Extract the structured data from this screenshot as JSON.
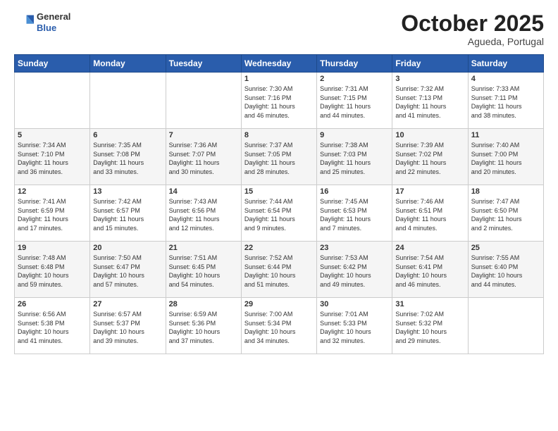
{
  "header": {
    "logo_general": "General",
    "logo_blue": "Blue",
    "month_title": "October 2025",
    "subtitle": "Agueda, Portugal"
  },
  "weekdays": [
    "Sunday",
    "Monday",
    "Tuesday",
    "Wednesday",
    "Thursday",
    "Friday",
    "Saturday"
  ],
  "weeks": [
    [
      {
        "day": "",
        "info": ""
      },
      {
        "day": "",
        "info": ""
      },
      {
        "day": "",
        "info": ""
      },
      {
        "day": "1",
        "info": "Sunrise: 7:30 AM\nSunset: 7:16 PM\nDaylight: 11 hours\nand 46 minutes."
      },
      {
        "day": "2",
        "info": "Sunrise: 7:31 AM\nSunset: 7:15 PM\nDaylight: 11 hours\nand 44 minutes."
      },
      {
        "day": "3",
        "info": "Sunrise: 7:32 AM\nSunset: 7:13 PM\nDaylight: 11 hours\nand 41 minutes."
      },
      {
        "day": "4",
        "info": "Sunrise: 7:33 AM\nSunset: 7:11 PM\nDaylight: 11 hours\nand 38 minutes."
      }
    ],
    [
      {
        "day": "5",
        "info": "Sunrise: 7:34 AM\nSunset: 7:10 PM\nDaylight: 11 hours\nand 36 minutes."
      },
      {
        "day": "6",
        "info": "Sunrise: 7:35 AM\nSunset: 7:08 PM\nDaylight: 11 hours\nand 33 minutes."
      },
      {
        "day": "7",
        "info": "Sunrise: 7:36 AM\nSunset: 7:07 PM\nDaylight: 11 hours\nand 30 minutes."
      },
      {
        "day": "8",
        "info": "Sunrise: 7:37 AM\nSunset: 7:05 PM\nDaylight: 11 hours\nand 28 minutes."
      },
      {
        "day": "9",
        "info": "Sunrise: 7:38 AM\nSunset: 7:03 PM\nDaylight: 11 hours\nand 25 minutes."
      },
      {
        "day": "10",
        "info": "Sunrise: 7:39 AM\nSunset: 7:02 PM\nDaylight: 11 hours\nand 22 minutes."
      },
      {
        "day": "11",
        "info": "Sunrise: 7:40 AM\nSunset: 7:00 PM\nDaylight: 11 hours\nand 20 minutes."
      }
    ],
    [
      {
        "day": "12",
        "info": "Sunrise: 7:41 AM\nSunset: 6:59 PM\nDaylight: 11 hours\nand 17 minutes."
      },
      {
        "day": "13",
        "info": "Sunrise: 7:42 AM\nSunset: 6:57 PM\nDaylight: 11 hours\nand 15 minutes."
      },
      {
        "day": "14",
        "info": "Sunrise: 7:43 AM\nSunset: 6:56 PM\nDaylight: 11 hours\nand 12 minutes."
      },
      {
        "day": "15",
        "info": "Sunrise: 7:44 AM\nSunset: 6:54 PM\nDaylight: 11 hours\nand 9 minutes."
      },
      {
        "day": "16",
        "info": "Sunrise: 7:45 AM\nSunset: 6:53 PM\nDaylight: 11 hours\nand 7 minutes."
      },
      {
        "day": "17",
        "info": "Sunrise: 7:46 AM\nSunset: 6:51 PM\nDaylight: 11 hours\nand 4 minutes."
      },
      {
        "day": "18",
        "info": "Sunrise: 7:47 AM\nSunset: 6:50 PM\nDaylight: 11 hours\nand 2 minutes."
      }
    ],
    [
      {
        "day": "19",
        "info": "Sunrise: 7:48 AM\nSunset: 6:48 PM\nDaylight: 10 hours\nand 59 minutes."
      },
      {
        "day": "20",
        "info": "Sunrise: 7:50 AM\nSunset: 6:47 PM\nDaylight: 10 hours\nand 57 minutes."
      },
      {
        "day": "21",
        "info": "Sunrise: 7:51 AM\nSunset: 6:45 PM\nDaylight: 10 hours\nand 54 minutes."
      },
      {
        "day": "22",
        "info": "Sunrise: 7:52 AM\nSunset: 6:44 PM\nDaylight: 10 hours\nand 51 minutes."
      },
      {
        "day": "23",
        "info": "Sunrise: 7:53 AM\nSunset: 6:42 PM\nDaylight: 10 hours\nand 49 minutes."
      },
      {
        "day": "24",
        "info": "Sunrise: 7:54 AM\nSunset: 6:41 PM\nDaylight: 10 hours\nand 46 minutes."
      },
      {
        "day": "25",
        "info": "Sunrise: 7:55 AM\nSunset: 6:40 PM\nDaylight: 10 hours\nand 44 minutes."
      }
    ],
    [
      {
        "day": "26",
        "info": "Sunrise: 6:56 AM\nSunset: 5:38 PM\nDaylight: 10 hours\nand 41 minutes."
      },
      {
        "day": "27",
        "info": "Sunrise: 6:57 AM\nSunset: 5:37 PM\nDaylight: 10 hours\nand 39 minutes."
      },
      {
        "day": "28",
        "info": "Sunrise: 6:59 AM\nSunset: 5:36 PM\nDaylight: 10 hours\nand 37 minutes."
      },
      {
        "day": "29",
        "info": "Sunrise: 7:00 AM\nSunset: 5:34 PM\nDaylight: 10 hours\nand 34 minutes."
      },
      {
        "day": "30",
        "info": "Sunrise: 7:01 AM\nSunset: 5:33 PM\nDaylight: 10 hours\nand 32 minutes."
      },
      {
        "day": "31",
        "info": "Sunrise: 7:02 AM\nSunset: 5:32 PM\nDaylight: 10 hours\nand 29 minutes."
      },
      {
        "day": "",
        "info": ""
      }
    ]
  ]
}
